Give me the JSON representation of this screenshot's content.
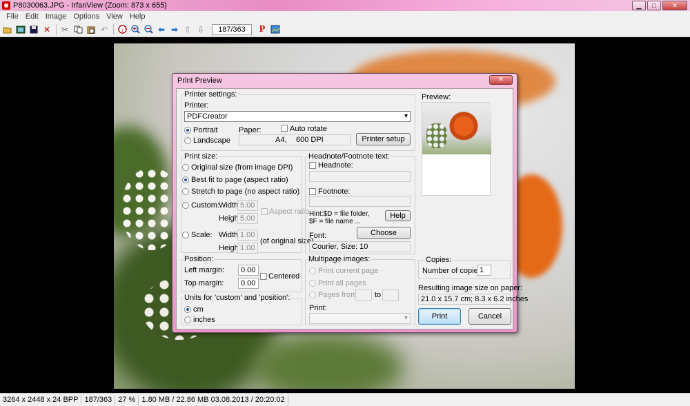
{
  "window": {
    "title": "P8030063.JPG - IrfanView (Zoom: 873 x 655)",
    "controls": [
      "minimize",
      "maximize",
      "close"
    ]
  },
  "menu": [
    "File",
    "Edit",
    "Image",
    "Options",
    "View",
    "Help"
  ],
  "toolbar": {
    "page_counter": "187/363",
    "icons": [
      "open-icon",
      "slideshow-icon",
      "save-icon",
      "delete-icon",
      "cut-icon",
      "copy-icon",
      "paste-icon",
      "undo-icon",
      "info-icon",
      "zoom-in-icon",
      "zoom-out-icon",
      "previous-icon",
      "next-icon",
      "first-icon",
      "last-icon",
      "print-icon",
      "paint-icon"
    ]
  },
  "statusbar": {
    "dimensions": "3264 x 2448 x 24 BPP",
    "index": "187/363",
    "zoom": "27 %",
    "filesize": "1.80 MB / 22.86 MB 03.08.2013 / 20:20:02"
  },
  "dialog": {
    "title": "Print Preview",
    "close": "✕",
    "printer_settings": {
      "title": "Printer settings:",
      "printer_label": "Printer:",
      "printer_value": "PDFCreator",
      "portrait": "Portrait",
      "landscape": "Landscape",
      "paper_label": "Paper:",
      "auto_rotate": "Auto rotate",
      "paper_value": "A4,",
      "dpi_value": "600 DPI",
      "setup_button": "Printer setup"
    },
    "print_size": {
      "title": "Print size:",
      "original": "Original size (from image DPI)",
      "best_fit": "Best fit to page (aspect ratio)",
      "stretch": "Stretch to page (no aspect ratio)",
      "custom": "Custom:",
      "width_label": "Width:",
      "width_value": "5.00",
      "height_label": "Height:",
      "height_value": "5.00",
      "aspect_ratio": "Aspect ratio",
      "scale": "Scale:",
      "scale_width_label": "Width:",
      "scale_width": "1.00",
      "scale_height_label": "Height:",
      "scale_height": "1.00",
      "of_original": "(of original size)"
    },
    "position": {
      "title": "Position:",
      "left_margin_label": "Left margin:",
      "left_margin": "0.00",
      "top_margin_label": "Top margin:",
      "top_margin": "0.00",
      "centered": "Centered"
    },
    "units": {
      "title": "Units for 'custom' and 'position':",
      "cm": "cm",
      "inches": "inches"
    },
    "headnote": {
      "title": "Headnote/Footnote text:",
      "headnote": "Headnote:",
      "footnote": "Footnote:",
      "hint_line1": "Hint:$D = file folder,",
      "hint_line2": "$F = file name ...",
      "help_button": "Help",
      "choose_button": "Choose",
      "font_label": "Font:",
      "font_value": "Courier, Size: 10"
    },
    "multipage": {
      "title": "Multipage images:",
      "current": "Print current page",
      "all": "Print all pages",
      "from": "Pages from:",
      "to": "to",
      "print_label": "Print:"
    },
    "preview_label": "Preview:",
    "copies": {
      "title": "Copies:",
      "label": "Number of copies:",
      "value": "1"
    },
    "result": {
      "title": "Resulting image size on paper:",
      "value": "21.0 x 15.7 cm; 8.3 x 6.2 inches"
    },
    "print_button": "Print",
    "cancel_button": "Cancel"
  }
}
